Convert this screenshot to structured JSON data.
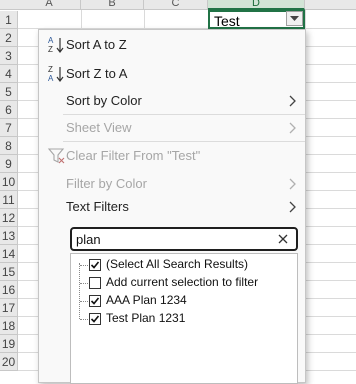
{
  "columns": [
    "A",
    "B",
    "C",
    "D"
  ],
  "rows": [
    "1",
    "2",
    "3",
    "4",
    "5",
    "6",
    "7",
    "8",
    "9",
    "10",
    "11",
    "12",
    "13",
    "14",
    "15",
    "16",
    "17",
    "18",
    "19",
    "20"
  ],
  "header_cell": {
    "value": "Test"
  },
  "menu": {
    "sort_az": "Sort A to Z",
    "sort_za": "Sort Z to A",
    "sort_by_color": "Sort by Color",
    "sheet_view": "Sheet View",
    "clear_filter": "Clear Filter From \"Test\"",
    "filter_by_color": "Filter by Color",
    "text_filters": "Text Filters"
  },
  "search": {
    "value": "plan "
  },
  "filter_list": [
    {
      "label": "(Select All Search Results)",
      "checked": true
    },
    {
      "label": "Add current selection to filter",
      "checked": false
    },
    {
      "label": "AAA Plan 1234",
      "checked": true
    },
    {
      "label": "Test Plan 1231",
      "checked": true
    }
  ],
  "colors": {
    "accent": "#217346",
    "disabled": "#a6a6a6"
  }
}
